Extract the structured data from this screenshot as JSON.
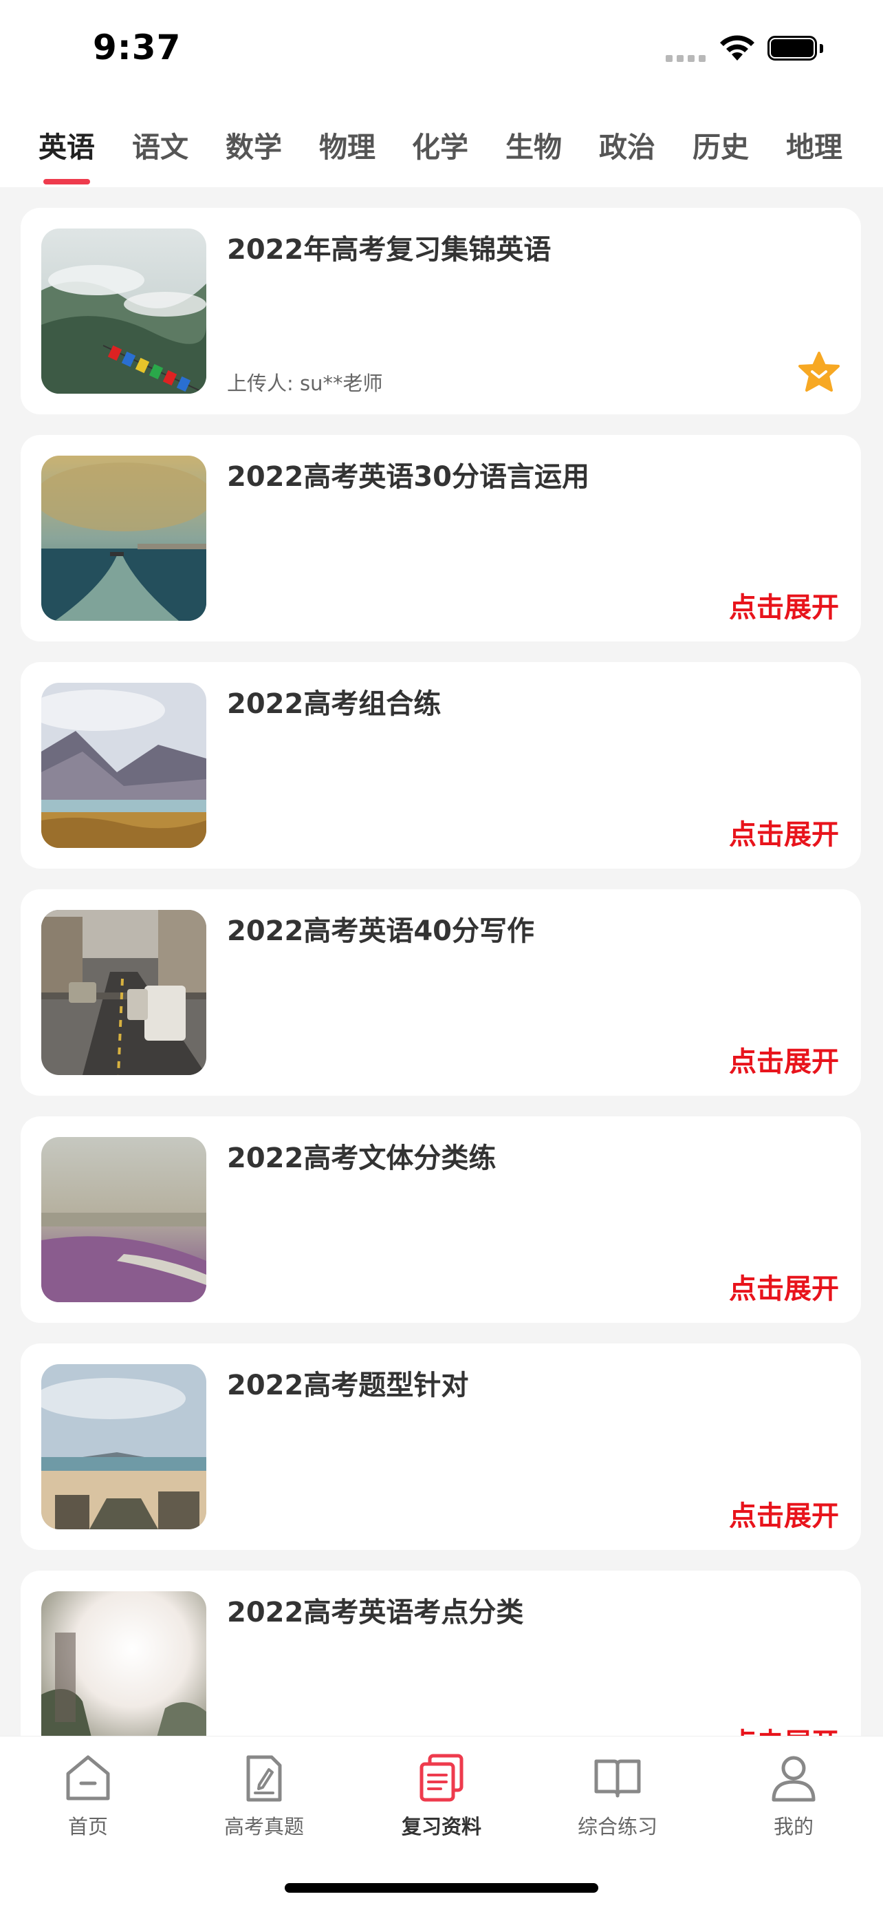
{
  "status_bar": {
    "time": "9:37"
  },
  "tabs": [
    {
      "label": "英语",
      "active": true
    },
    {
      "label": "语文"
    },
    {
      "label": "数学"
    },
    {
      "label": "物理"
    },
    {
      "label": "化学"
    },
    {
      "label": "生物"
    },
    {
      "label": "政治"
    },
    {
      "label": "历史"
    },
    {
      "label": "地理"
    }
  ],
  "cards": [
    {
      "title": "2022年高考复习集锦英语",
      "uploader": "上传人: su**老师",
      "thumb_icon": "mountain-flags-photo",
      "badge_icon": "star-badge-icon"
    },
    {
      "title": "2022高考英语30分语言运用",
      "action": "点击展开",
      "thumb_icon": "sea-boat-photo"
    },
    {
      "title": "2022高考组合练",
      "action": "点击展开",
      "thumb_icon": "mountain-lake-photo"
    },
    {
      "title": "2022高考英语40分写作",
      "action": "点击展开",
      "thumb_icon": "city-street-photo"
    },
    {
      "title": "2022高考文体分类练",
      "action": "点击展开",
      "thumb_icon": "beach-shore-photo"
    },
    {
      "title": "2022高考题型针对",
      "action": "点击展开",
      "thumb_icon": "beach-boardwalk-photo"
    },
    {
      "title": "2022高考英语考点分类",
      "action": "点击展开",
      "thumb_icon": "sunlight-person-photo"
    }
  ],
  "bottom_nav": [
    {
      "label": "首页",
      "icon": "home-icon"
    },
    {
      "label": "高考真题",
      "icon": "exam-paper-icon"
    },
    {
      "label": "复习资料",
      "icon": "review-docs-icon",
      "active": true
    },
    {
      "label": "综合练习",
      "icon": "book-icon"
    },
    {
      "label": "我的",
      "icon": "profile-icon"
    }
  ],
  "colors": {
    "accent": "#ee3b4d",
    "action_text": "#e8141c",
    "star": "#f7a823",
    "background": "#f4f4f4"
  }
}
